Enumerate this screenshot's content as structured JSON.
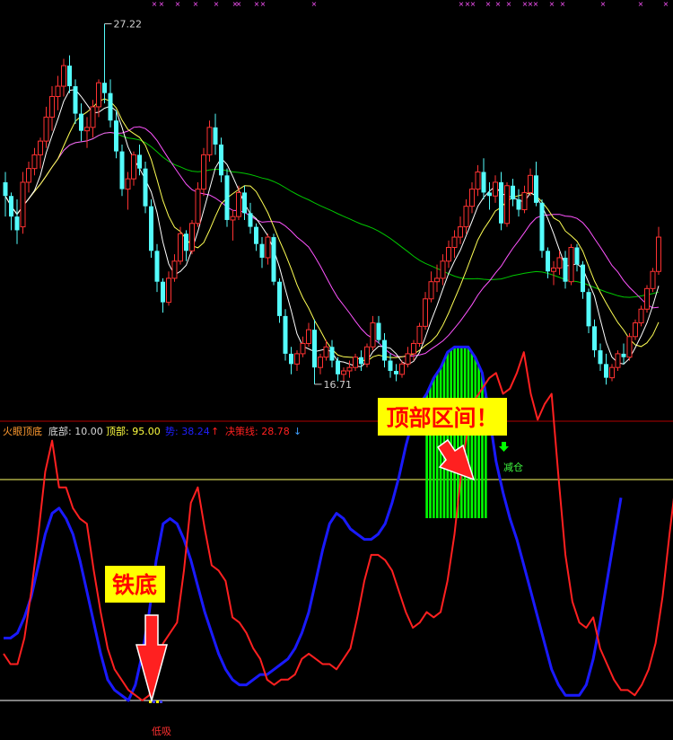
{
  "colors": {
    "background": "#000000",
    "up": "#ff3232",
    "down": "#54fcfc",
    "ma_fast": "#ffffff",
    "ma_mid": "#ffff54",
    "ma_slow": "#ff54ff",
    "ma_long": "#00c800",
    "osc_red": "#ff2020",
    "osc_blue": "#1a1aff",
    "top_line": "#ffff66",
    "bottom_line": "#ffffff",
    "top_bars": "#00ff00",
    "callout_bg": "#ffff00",
    "callout_text": "#ff0000",
    "arrow": "#ff2020",
    "label_red": "#ff3030",
    "label_green": "#40ff40",
    "cross": "#ff54ff"
  },
  "price_panel": {
    "high_label": "27.22",
    "low_label": "16.71",
    "crosses_count_hint": ""
  },
  "indicator_header": {
    "name": "火眼顶底",
    "bottom_label": "底部: 10.00",
    "top_label": "顶部: 95.00",
    "trend_label": "势: 38.24",
    "trend_arrow": "↑",
    "decision_label": "决策线: 28.78",
    "decision_arrow": "↓"
  },
  "annotations": {
    "top_zone": "顶部区间！",
    "iron_bottom": "铁底",
    "reduce": "减仓",
    "low_buy": "低吸",
    "reduce_arrow": "🡇"
  },
  "chart_data": [
    {
      "type": "candlestick",
      "title": "",
      "ylim": [
        16.0,
        27.6
      ],
      "annotations": [
        {
          "label": "27.22",
          "value": 27.22,
          "index": 17
        },
        {
          "label": "16.71",
          "value": 16.71,
          "index": 53
        }
      ],
      "candles": [
        [
          22.6,
          22.9,
          21.6,
          22.2
        ],
        [
          22.2,
          22.3,
          21.2,
          21.6
        ],
        [
          21.6,
          22.1,
          20.8,
          21.2
        ],
        [
          21.3,
          22.9,
          21.1,
          22.6
        ],
        [
          22.6,
          23.2,
          22.3,
          23.0
        ],
        [
          23.0,
          23.6,
          22.8,
          23.4
        ],
        [
          23.4,
          23.9,
          23.0,
          23.8
        ],
        [
          23.8,
          24.8,
          23.6,
          24.5
        ],
        [
          24.5,
          25.4,
          24.1,
          25.1
        ],
        [
          25.1,
          25.7,
          24.7,
          25.4
        ],
        [
          25.4,
          26.2,
          25.1,
          26.0
        ],
        [
          26.0,
          26.3,
          25.2,
          25.4
        ],
        [
          25.4,
          25.6,
          24.3,
          24.6
        ],
        [
          24.6,
          24.9,
          23.8,
          24.1
        ],
        [
          24.1,
          24.5,
          23.6,
          24.2
        ],
        [
          24.2,
          25.0,
          23.9,
          24.8
        ],
        [
          24.8,
          25.6,
          24.5,
          25.5
        ],
        [
          25.5,
          27.22,
          24.9,
          25.2
        ],
        [
          25.2,
          25.6,
          24.2,
          24.4
        ],
        [
          24.4,
          24.7,
          23.3,
          23.5
        ],
        [
          23.5,
          23.7,
          22.2,
          22.4
        ],
        [
          22.4,
          22.9,
          21.8,
          22.7
        ],
        [
          22.7,
          23.5,
          22.5,
          23.4
        ],
        [
          23.4,
          23.7,
          22.8,
          23.0
        ],
        [
          23.0,
          23.2,
          21.7,
          21.9
        ],
        [
          21.9,
          22.1,
          20.4,
          20.6
        ],
        [
          20.6,
          20.8,
          19.4,
          19.7
        ],
        [
          19.7,
          19.8,
          18.8,
          19.1
        ],
        [
          19.1,
          20.0,
          19.0,
          19.8
        ],
        [
          19.8,
          20.5,
          19.7,
          20.3
        ],
        [
          20.3,
          21.3,
          20.2,
          21.1
        ],
        [
          21.1,
          21.2,
          20.3,
          20.6
        ],
        [
          20.6,
          21.5,
          20.5,
          21.4
        ],
        [
          21.4,
          22.6,
          21.3,
          22.4
        ],
        [
          22.4,
          23.6,
          22.2,
          23.4
        ],
        [
          23.4,
          24.4,
          23.2,
          24.2
        ],
        [
          24.2,
          24.6,
          23.4,
          23.7
        ],
        [
          23.7,
          23.9,
          22.6,
          22.8
        ],
        [
          22.8,
          23.0,
          21.3,
          21.5
        ],
        [
          21.5,
          21.8,
          20.9,
          21.6
        ],
        [
          21.6,
          22.5,
          21.5,
          22.3
        ],
        [
          22.3,
          22.5,
          21.5,
          21.7
        ],
        [
          21.7,
          22.0,
          21.1,
          21.3
        ],
        [
          21.3,
          21.4,
          20.6,
          20.8
        ],
        [
          20.8,
          21.0,
          20.1,
          20.4
        ],
        [
          20.4,
          21.1,
          20.2,
          21.0
        ],
        [
          21.0,
          21.1,
          19.6,
          19.7
        ],
        [
          19.7,
          19.8,
          18.5,
          18.7
        ],
        [
          18.7,
          18.9,
          17.4,
          17.6
        ],
        [
          17.6,
          17.8,
          17.0,
          17.3
        ],
        [
          17.3,
          17.7,
          17.1,
          17.6
        ],
        [
          17.6,
          18.1,
          17.5,
          17.9
        ],
        [
          17.9,
          18.5,
          17.8,
          18.3
        ],
        [
          18.3,
          18.6,
          16.71,
          17.2
        ],
        [
          17.2,
          17.6,
          17.0,
          17.5
        ],
        [
          17.5,
          18.0,
          17.4,
          17.8
        ],
        [
          17.8,
          18.0,
          17.2,
          17.4
        ],
        [
          17.4,
          17.5,
          16.8,
          17.0
        ],
        [
          17.0,
          17.2,
          16.8,
          17.1
        ],
        [
          17.1,
          17.4,
          16.9,
          17.2
        ],
        [
          17.2,
          17.6,
          17.1,
          17.5
        ],
        [
          17.5,
          17.7,
          17.1,
          17.3
        ],
        [
          17.3,
          17.9,
          17.2,
          17.8
        ],
        [
          17.8,
          18.7,
          17.7,
          18.5
        ],
        [
          18.5,
          18.7,
          17.9,
          18.0
        ],
        [
          18.0,
          18.2,
          17.2,
          17.4
        ],
        [
          17.4,
          17.6,
          16.9,
          17.1
        ],
        [
          17.1,
          17.3,
          16.8,
          17.0
        ],
        [
          17.0,
          17.4,
          16.9,
          17.3
        ],
        [
          17.3,
          17.8,
          17.2,
          17.6
        ],
        [
          17.6,
          18.0,
          17.4,
          17.9
        ],
        [
          17.9,
          18.5,
          17.8,
          18.4
        ],
        [
          18.4,
          19.4,
          18.3,
          19.2
        ],
        [
          19.2,
          20.0,
          19.1,
          19.7
        ],
        [
          19.7,
          20.2,
          19.4,
          19.8
        ],
        [
          19.8,
          20.5,
          19.6,
          20.3
        ],
        [
          20.3,
          20.9,
          20.1,
          20.7
        ],
        [
          20.7,
          21.2,
          20.4,
          21.0
        ],
        [
          21.0,
          21.6,
          20.8,
          21.3
        ],
        [
          21.3,
          22.1,
          21.1,
          21.9
        ],
        [
          21.9,
          22.6,
          21.7,
          22.4
        ],
        [
          22.4,
          23.1,
          22.2,
          22.9
        ],
        [
          22.9,
          23.3,
          22.1,
          22.3
        ],
        [
          22.3,
          22.6,
          21.8,
          22.2
        ],
        [
          22.2,
          22.8,
          22.0,
          22.6
        ],
        [
          22.6,
          22.9,
          21.2,
          21.4
        ],
        [
          21.4,
          22.6,
          21.3,
          22.5
        ],
        [
          22.5,
          22.7,
          21.9,
          22.1
        ],
        [
          22.1,
          22.4,
          21.6,
          21.8
        ],
        [
          21.8,
          22.5,
          21.7,
          22.3
        ],
        [
          22.3,
          23.0,
          22.2,
          22.8
        ],
        [
          22.8,
          23.2,
          21.9,
          22.0
        ],
        [
          22.0,
          22.1,
          20.4,
          20.6
        ],
        [
          20.6,
          20.7,
          19.8,
          20.0
        ],
        [
          20.0,
          20.3,
          19.6,
          20.1
        ],
        [
          20.1,
          20.6,
          19.9,
          20.4
        ],
        [
          20.4,
          20.6,
          19.5,
          19.7
        ],
        [
          19.7,
          20.8,
          19.6,
          20.7
        ],
        [
          20.7,
          20.8,
          20.0,
          20.2
        ],
        [
          20.2,
          20.3,
          19.2,
          19.4
        ],
        [
          19.4,
          19.5,
          18.2,
          18.4
        ],
        [
          18.4,
          18.6,
          17.5,
          17.7
        ],
        [
          17.7,
          17.9,
          17.1,
          17.3
        ],
        [
          17.3,
          17.6,
          16.7,
          16.9
        ],
        [
          16.9,
          17.3,
          16.8,
          17.2
        ],
        [
          17.2,
          17.7,
          17.1,
          17.6
        ],
        [
          17.6,
          17.9,
          17.3,
          17.5
        ],
        [
          17.5,
          18.2,
          17.4,
          18.1
        ],
        [
          18.1,
          18.6,
          18.0,
          18.5
        ],
        [
          18.5,
          19.0,
          18.4,
          18.9
        ],
        [
          18.9,
          19.6,
          18.8,
          19.5
        ],
        [
          19.5,
          20.1,
          19.4,
          20.0
        ],
        [
          20.0,
          21.3,
          19.9,
          21.0
        ]
      ]
    },
    {
      "type": "line",
      "title": "",
      "ylim": [
        -8,
        160
      ],
      "top_level": 95.0,
      "bottom_level": 10.0,
      "series": [
        {
          "values": [
            28,
            24,
            24,
            34,
            52,
            74,
            98,
            110,
            92,
            92,
            84,
            80,
            78,
            60,
            44,
            30,
            22,
            18,
            14,
            12,
            10,
            12,
            24,
            32,
            36,
            40,
            60,
            86,
            92,
            76,
            62,
            60,
            56,
            42,
            40,
            36,
            30,
            26,
            18,
            16,
            18,
            18,
            20,
            26,
            28,
            26,
            24,
            24,
            22,
            26,
            30,
            42,
            56,
            66,
            66,
            64,
            60,
            52,
            44,
            38,
            40,
            44,
            42,
            44,
            56,
            74,
            98,
            116,
            126,
            130,
            134,
            136,
            128,
            130,
            136,
            144,
            128,
            118,
            124,
            128,
            96,
            66,
            48,
            40,
            38,
            42,
            30,
            24,
            18,
            14,
            14,
            12,
            16,
            22,
            32,
            50,
            74,
            96
          ]
        },
        {
          "values": [
            34,
            34,
            36,
            42,
            50,
            62,
            74,
            82,
            84,
            80,
            74,
            64,
            52,
            40,
            28,
            18,
            14,
            12,
            10,
            16,
            28,
            44,
            64,
            78,
            80,
            78,
            72,
            64,
            54,
            44,
            36,
            28,
            22,
            18,
            16,
            16,
            18,
            20,
            20,
            22,
            24,
            26,
            30,
            36,
            44,
            56,
            68,
            78,
            82,
            80,
            76,
            74,
            72,
            72,
            74,
            78,
            86,
            96,
            108,
            118,
            124,
            128,
            134,
            138,
            144,
            146,
            146,
            146,
            142,
            136,
            120,
            102,
            90,
            80,
            72,
            62,
            52,
            42,
            32,
            22,
            16,
            12,
            12,
            12,
            16,
            26,
            40,
            56,
            72,
            88
          ]
        }
      ]
    }
  ]
}
